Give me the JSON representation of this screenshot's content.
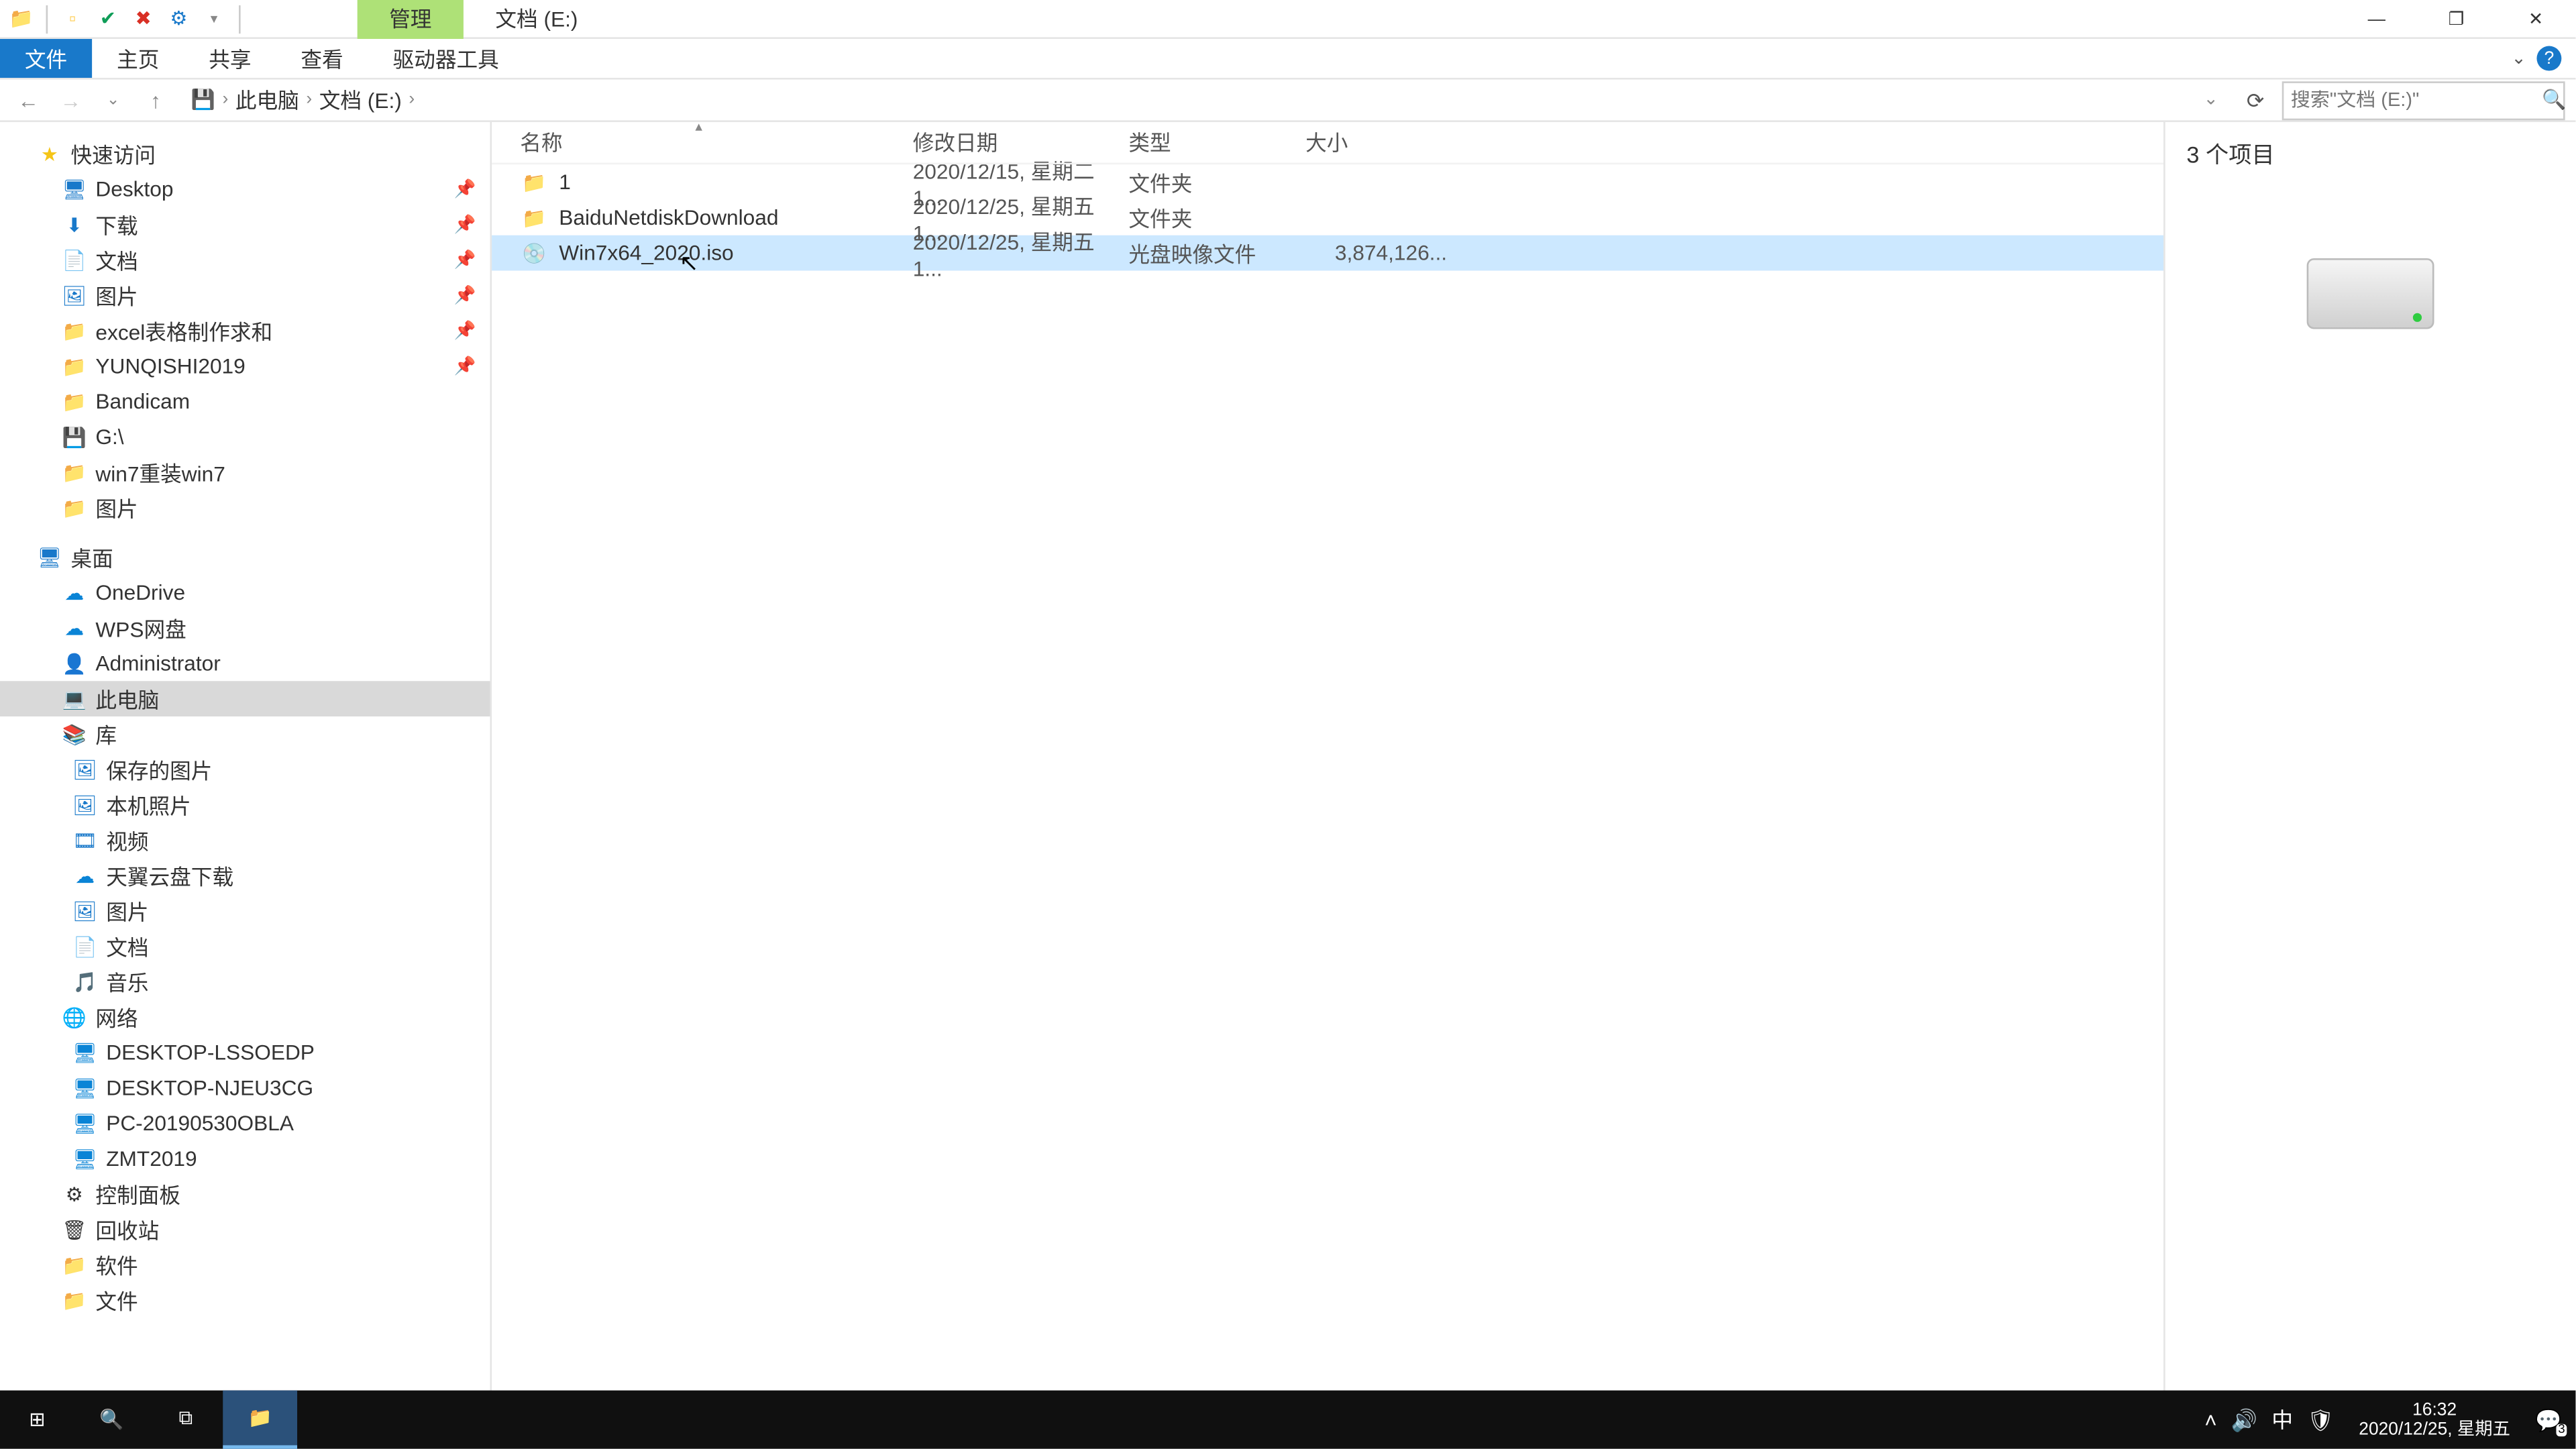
{
  "window": {
    "contextual_tab": "管理",
    "title": "文档 (E:)",
    "minimize": "—",
    "maximize": "❐",
    "close": "✕"
  },
  "ribbon": {
    "file": "文件",
    "tabs": [
      "主页",
      "共享",
      "查看",
      "驱动器工具"
    ],
    "expand": "⌄",
    "help": "?"
  },
  "address": {
    "back": "←",
    "forward": "→",
    "recent_dropdown": "⌄",
    "up": "↑",
    "crumbs": [
      "此电脑",
      "文档 (E:)"
    ],
    "sep": "›",
    "dropdown": "⌄",
    "refresh": "⟳",
    "search_placeholder": "搜索\"文档 (E:)\"",
    "search_icon": "🔍"
  },
  "tree": {
    "quick_access": {
      "label": "快速访问",
      "items": [
        {
          "label": "Desktop",
          "icon": "🖥",
          "pinned": true
        },
        {
          "label": "下载",
          "icon": "⬇",
          "pinned": true
        },
        {
          "label": "文档",
          "icon": "📄",
          "pinned": true
        },
        {
          "label": "图片",
          "icon": "🖼",
          "pinned": true
        },
        {
          "label": "excel表格制作求和",
          "icon": "📁",
          "pinned": true
        },
        {
          "label": "YUNQISHI2019",
          "icon": "📁",
          "pinned": true
        },
        {
          "label": "Bandicam",
          "icon": "📁"
        },
        {
          "label": "G:\\",
          "icon": "💾"
        },
        {
          "label": "win7重装win7",
          "icon": "📁"
        },
        {
          "label": "图片",
          "icon": "📁"
        }
      ]
    },
    "desktop": {
      "label": "桌面",
      "items": [
        {
          "label": "OneDrive",
          "icon": "☁"
        },
        {
          "label": "WPS网盘",
          "icon": "☁"
        },
        {
          "label": "Administrator",
          "icon": "👤"
        },
        {
          "label": "此电脑",
          "icon": "💻",
          "selected": true
        },
        {
          "label": "库",
          "icon": "📚"
        }
      ]
    },
    "libraries": [
      {
        "label": "保存的图片",
        "icon": "🖼"
      },
      {
        "label": "本机照片",
        "icon": "🖼"
      },
      {
        "label": "视频",
        "icon": "🎞"
      },
      {
        "label": "天翼云盘下载",
        "icon": "☁"
      },
      {
        "label": "图片",
        "icon": "🖼"
      },
      {
        "label": "文档",
        "icon": "📄"
      },
      {
        "label": "音乐",
        "icon": "🎵"
      }
    ],
    "network": {
      "label": "网络",
      "items": [
        {
          "label": "DESKTOP-LSSOEDP",
          "icon": "🖥"
        },
        {
          "label": "DESKTOP-NJEU3CG",
          "icon": "🖥"
        },
        {
          "label": "PC-20190530OBLA",
          "icon": "🖥"
        },
        {
          "label": "ZMT2019",
          "icon": "🖥"
        }
      ]
    },
    "misc": [
      {
        "label": "控制面板",
        "icon": "⚙"
      },
      {
        "label": "回收站",
        "icon": "🗑"
      },
      {
        "label": "软件",
        "icon": "📁"
      },
      {
        "label": "文件",
        "icon": "📁"
      }
    ]
  },
  "columns": {
    "name": "名称",
    "date": "修改日期",
    "type": "类型",
    "size": "大小",
    "sort": "▴"
  },
  "files": [
    {
      "name": "1",
      "icon": "📁",
      "date": "2020/12/15, 星期二 1...",
      "type": "文件夹",
      "size": ""
    },
    {
      "name": "BaiduNetdiskDownload",
      "icon": "📁",
      "date": "2020/12/25, 星期五 1...",
      "type": "文件夹",
      "size": ""
    },
    {
      "name": "Win7x64_2020.iso",
      "icon": "💿",
      "date": "2020/12/25, 星期五 1...",
      "type": "光盘映像文件",
      "size": "3,874,126...",
      "selected": true
    }
  ],
  "preview": {
    "count": "3 个项目"
  },
  "status": {
    "text": "3 个项目"
  },
  "taskbar": {
    "time": "16:32",
    "date": "2020/12/25, 星期五",
    "ime": "中",
    "notification_badge": "3"
  }
}
